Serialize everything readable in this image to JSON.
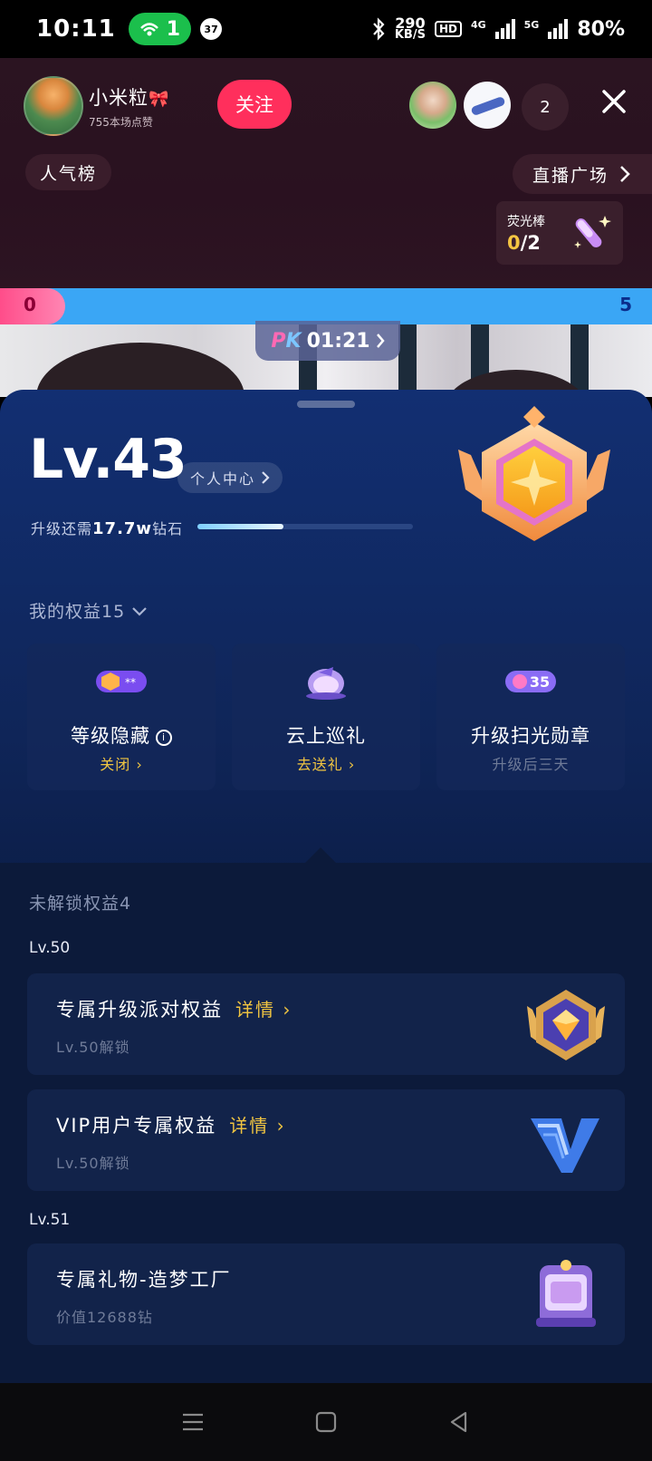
{
  "status_bar": {
    "time": "10:11",
    "hotspot_count": "1",
    "notif_count": "37",
    "speed_value": "290",
    "speed_unit": "KB/S",
    "hd_label": "HD",
    "net1": "4G",
    "net2": "5G",
    "battery": "80%"
  },
  "live": {
    "host_name": "小米粒",
    "host_bow": "🎀",
    "host_likes": "755本场点赞",
    "follow_label": "关注",
    "viewer_count": "2",
    "rank_label": "人气榜",
    "square_label": "直播广场",
    "glow_title": "荧光棒",
    "glow_current": "0",
    "glow_total": "/2"
  },
  "pk": {
    "left_score": "0",
    "right_score": "5",
    "logo_p": "P",
    "logo_k": "K",
    "timer": "01:21"
  },
  "sheet": {
    "level": "Lv.43",
    "center_label": "个人中心",
    "upgrade_prefix": "升级还需",
    "upgrade_amount": "17.7w",
    "upgrade_suffix": "钻石",
    "progress": 0.4,
    "rights_title": "我的权益15",
    "cards": [
      {
        "title": "等级隐藏",
        "sub": "关闭",
        "badge": "**"
      },
      {
        "title": "云上巡礼",
        "sub": "去送礼"
      },
      {
        "title": "升级扫光勋章",
        "sub": "升级后三天",
        "badge": "35"
      }
    ],
    "unlock_title": "未解锁权益4",
    "groups": [
      {
        "level": "Lv.50",
        "items": [
          {
            "title": "专属升级派对权益",
            "more": "详情",
            "sub": "Lv.50解锁"
          },
          {
            "title": "VIP用户专属权益",
            "more": "详情",
            "sub": "Lv.50解锁"
          }
        ]
      },
      {
        "level": "Lv.51",
        "items": [
          {
            "title": "专属礼物-造梦工厂",
            "sub": "价值12688钻"
          }
        ]
      }
    ]
  },
  "colors": {
    "accent_pink": "#ff2f5c",
    "gold": "#f1c541",
    "pk_blue": "#3aa6f5"
  }
}
